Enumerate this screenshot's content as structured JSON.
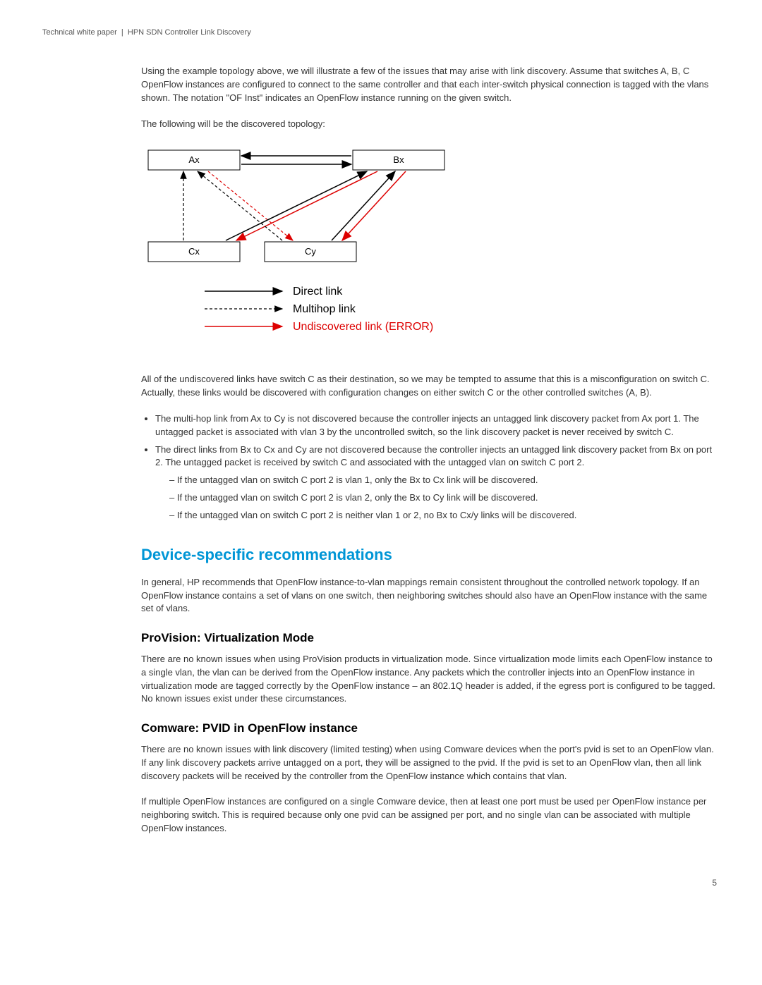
{
  "header": {
    "doc_type": "Technical white paper",
    "title": "HPN SDN Controller Link Discovery"
  },
  "intro_p1": "Using the example topology above, we will illustrate a few of the issues that may arise with link discovery. Assume that switches A, B, C OpenFlow instances are configured to connect to the same controller and that each inter-switch physical connection is tagged with the vlans shown. The notation \"OF Inst\" indicates an OpenFlow instance running on the given switch.",
  "intro_p2": "The following will be the discovered topology:",
  "diagram": {
    "nodes": {
      "ax": "Ax",
      "bx": "Bx",
      "cx": "Cx",
      "cy": "Cy"
    },
    "legend": {
      "direct": "Direct link",
      "multihop": "Multihop link",
      "error": "Undiscovered link (ERROR)"
    }
  },
  "after_diagram_p": "All of the undiscovered links have switch C as their destination, so we may be tempted to assume that this is a misconfiguration on switch C. Actually, these links would be discovered with configuration changes on either switch C or the other controlled switches (A, B).",
  "bullets": {
    "b1": "The multi-hop link from Ax to Cy is not discovered because the controller injects an untagged link discovery packet from Ax port 1. The untagged packet is associated with vlan 3 by the uncontrolled switch, so the link discovery packet is never received by switch C.",
    "b2": "The direct links from Bx to Cx and Cy are not discovered because the controller injects an untagged link discovery packet from Bx on port 2. The untagged packet is received by switch C and associated with the untagged vlan on switch C port 2.",
    "b2_sub": {
      "s1": "If the untagged vlan on switch C port 2 is vlan 1, only the Bx to Cx link will be discovered.",
      "s2": "If the untagged vlan on switch C port 2 is vlan 2, only the Bx to Cy link will be discovered.",
      "s3": "If the untagged vlan on switch C port 2 is neither vlan 1 or 2, no Bx to Cx/y links will be discovered."
    }
  },
  "section_heading": "Device-specific recommendations",
  "section_intro": "In general, HP recommends that OpenFlow instance-to-vlan mappings remain consistent throughout the controlled network topology. If an OpenFlow instance contains a set of vlans on one switch, then neighboring switches should also have an OpenFlow instance with the same set of vlans.",
  "sub1_heading": "ProVision: Virtualization Mode",
  "sub1_p": "There are no known issues when using ProVision products in virtualization mode. Since virtualization mode limits each OpenFlow instance to a single vlan, the vlan can be derived from the OpenFlow instance. Any packets which the controller injects into an OpenFlow instance in virtualization mode are tagged correctly by the OpenFlow instance – an 802.1Q header is added, if the egress port is configured to be tagged. No known issues exist under these circumstances.",
  "sub2_heading": "Comware: PVID in OpenFlow instance",
  "sub2_p1": "There are no known issues with link discovery (limited testing) when using Comware devices when the port's pvid is set to an OpenFlow vlan. If any link discovery packets arrive untagged on a port, they will be assigned to the pvid. If the pvid is set to an OpenFlow vlan, then all link discovery packets will be received by the controller from the OpenFlow instance which contains that vlan.",
  "sub2_p2": "If multiple OpenFlow instances are configured on a single Comware device, then at least one port must be used per OpenFlow instance per neighboring switch. This is required because only one pvid can be assigned per port, and no single vlan can be associated with multiple OpenFlow instances.",
  "page_number": "5"
}
